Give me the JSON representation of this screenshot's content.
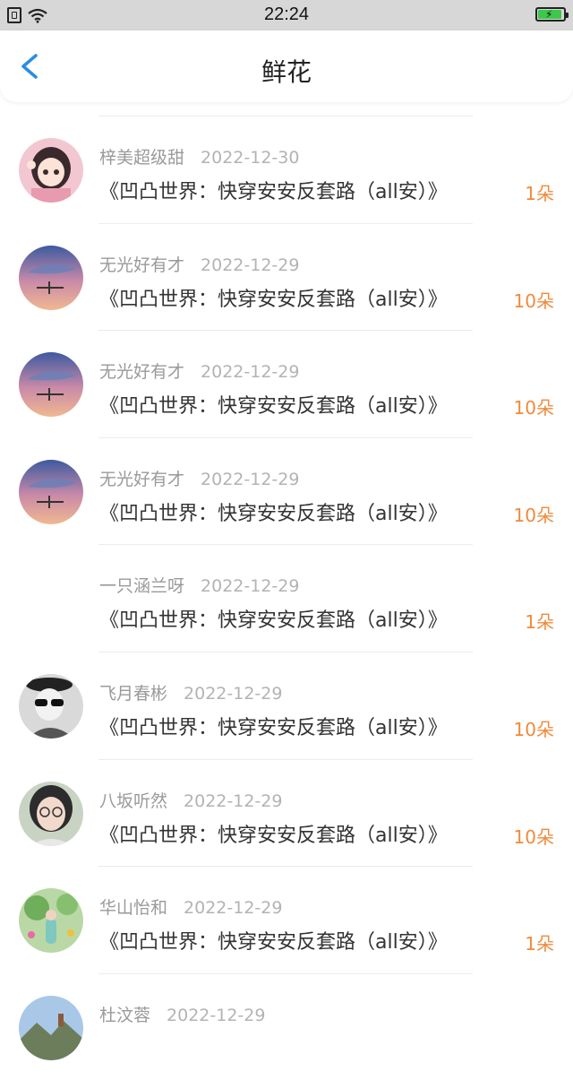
{
  "status_bar": {
    "time": "22:24"
  },
  "nav": {
    "title": "鲜花"
  },
  "items": [
    {
      "user": "梓美超级甜",
      "date": "2022-12-30",
      "book": "《凹凸世界：快穿安安反套路（all安）》",
      "amount": "1朵",
      "avatar": "anime-girl"
    },
    {
      "user": "无光好有才",
      "date": "2022-12-29",
      "book": "《凹凸世界：快穿安安反套路（all安）》",
      "amount": "10朵",
      "avatar": "sky-whale"
    },
    {
      "user": "无光好有才",
      "date": "2022-12-29",
      "book": "《凹凸世界：快穿安安反套路（all安）》",
      "amount": "10朵",
      "avatar": "sky-whale"
    },
    {
      "user": "无光好有才",
      "date": "2022-12-29",
      "book": "《凹凸世界：快穿安安反套路（all安）》",
      "amount": "10朵",
      "avatar": "sky-whale"
    },
    {
      "user": "一只涵兰呀",
      "date": "2022-12-29",
      "book": "《凹凸世界：快穿安安反套路（all安）》",
      "amount": "1朵",
      "avatar": "none"
    },
    {
      "user": "飞月春彬",
      "date": "2022-12-29",
      "book": "《凹凸世界：快穿安安反套路（all安）》",
      "amount": "10朵",
      "avatar": "sunglasses"
    },
    {
      "user": "八坂听然",
      "date": "2022-12-29",
      "book": "《凹凸世界：快穿安安反套路（all安）》",
      "amount": "10朵",
      "avatar": "glasses-girl"
    },
    {
      "user": "华山怡和",
      "date": "2022-12-29",
      "book": "《凹凸世界：快穿安安反套路（all安）》",
      "amount": "1朵",
      "avatar": "garden"
    },
    {
      "user": "杜汶蓉",
      "date": "2022-12-29",
      "book": "",
      "amount": "",
      "avatar": "landscape"
    }
  ]
}
